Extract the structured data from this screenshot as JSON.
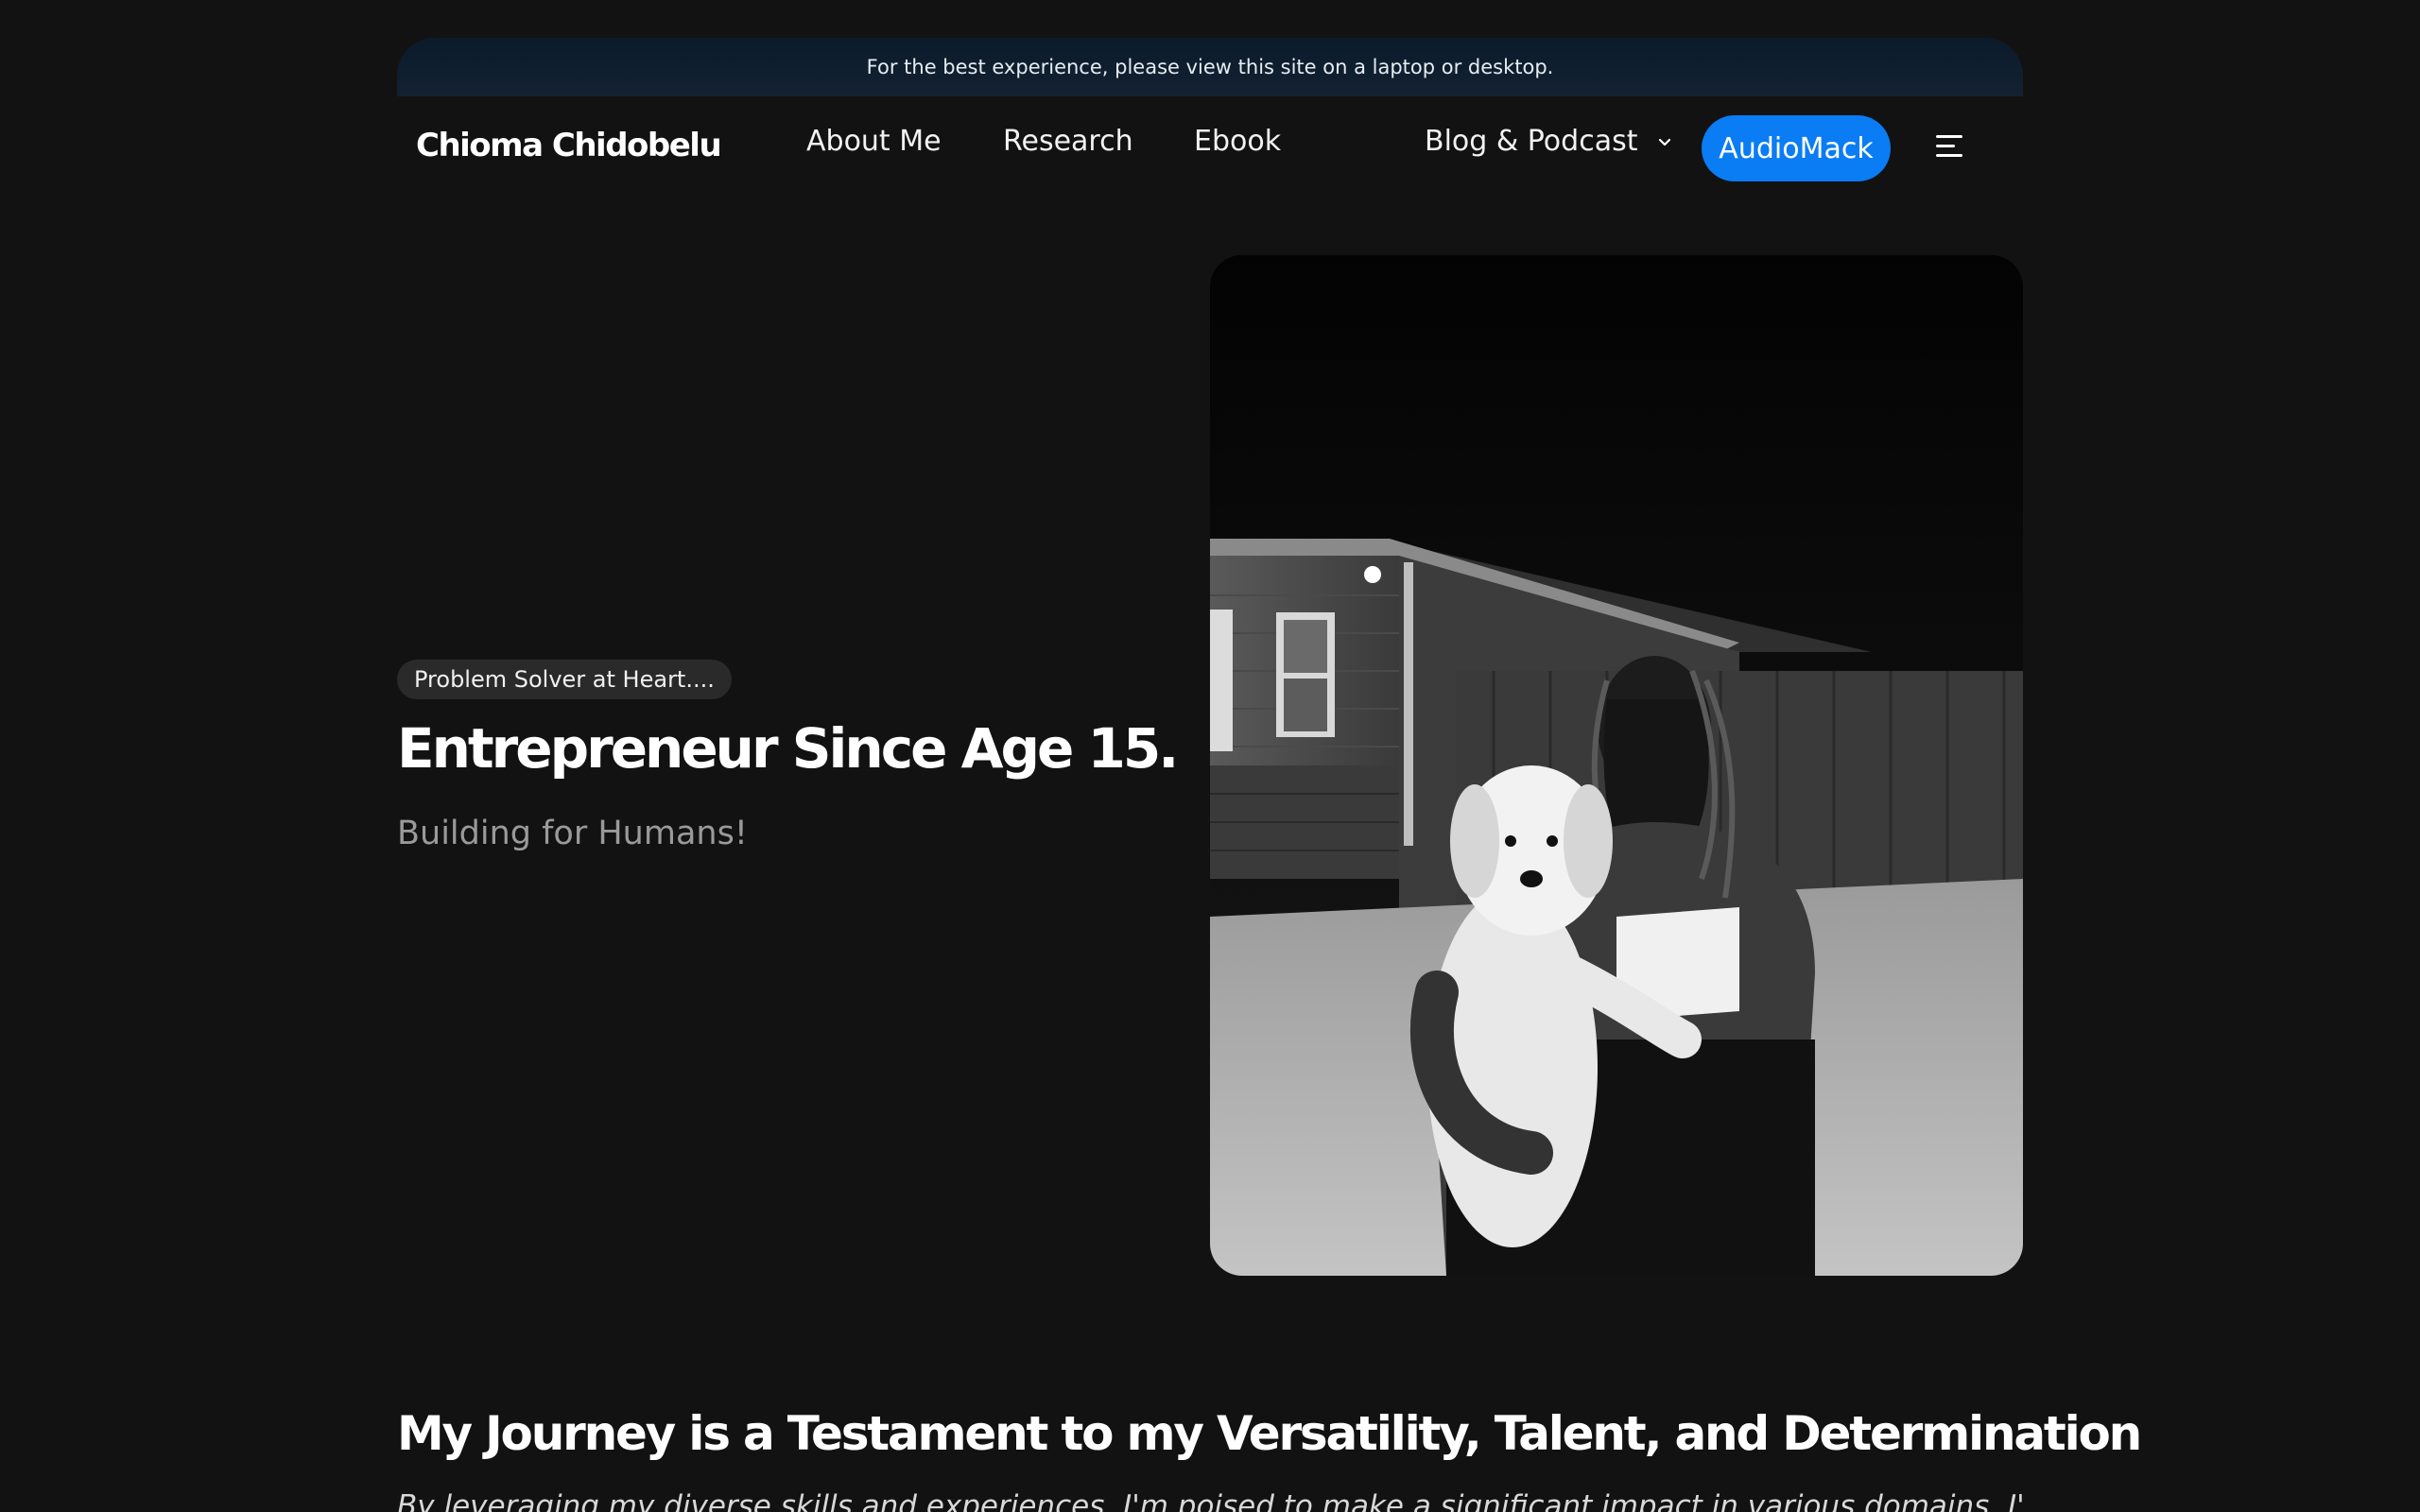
{
  "banner": {
    "text": "For the best experience, please view this site on a laptop or desktop."
  },
  "nav": {
    "logo": "Chioma Chidobelu",
    "links": [
      {
        "label": "About Me"
      },
      {
        "label": "Research"
      },
      {
        "label": "Ebook"
      },
      {
        "label": "Blog & Podcast",
        "icon": "chevron-down-icon"
      }
    ],
    "cta": "AudioMack",
    "menu_icon": "hamburger-menu-icon"
  },
  "hero": {
    "tag": "Problem Solver at Heart....",
    "title": "Entrepreneur Since Age 15.",
    "subtitle": "Building for Humans!"
  },
  "journey": {
    "title": "My Journey is a Testament to my Versatility, Talent, and Determination",
    "body": "By leveraging my diverse skills and experiences, I'm poised to make a significant impact in various domains. I'll keep striving for"
  },
  "colors": {
    "background": "#121212",
    "accent": "#0a7cf4",
    "pill": "#2a2a2a"
  }
}
